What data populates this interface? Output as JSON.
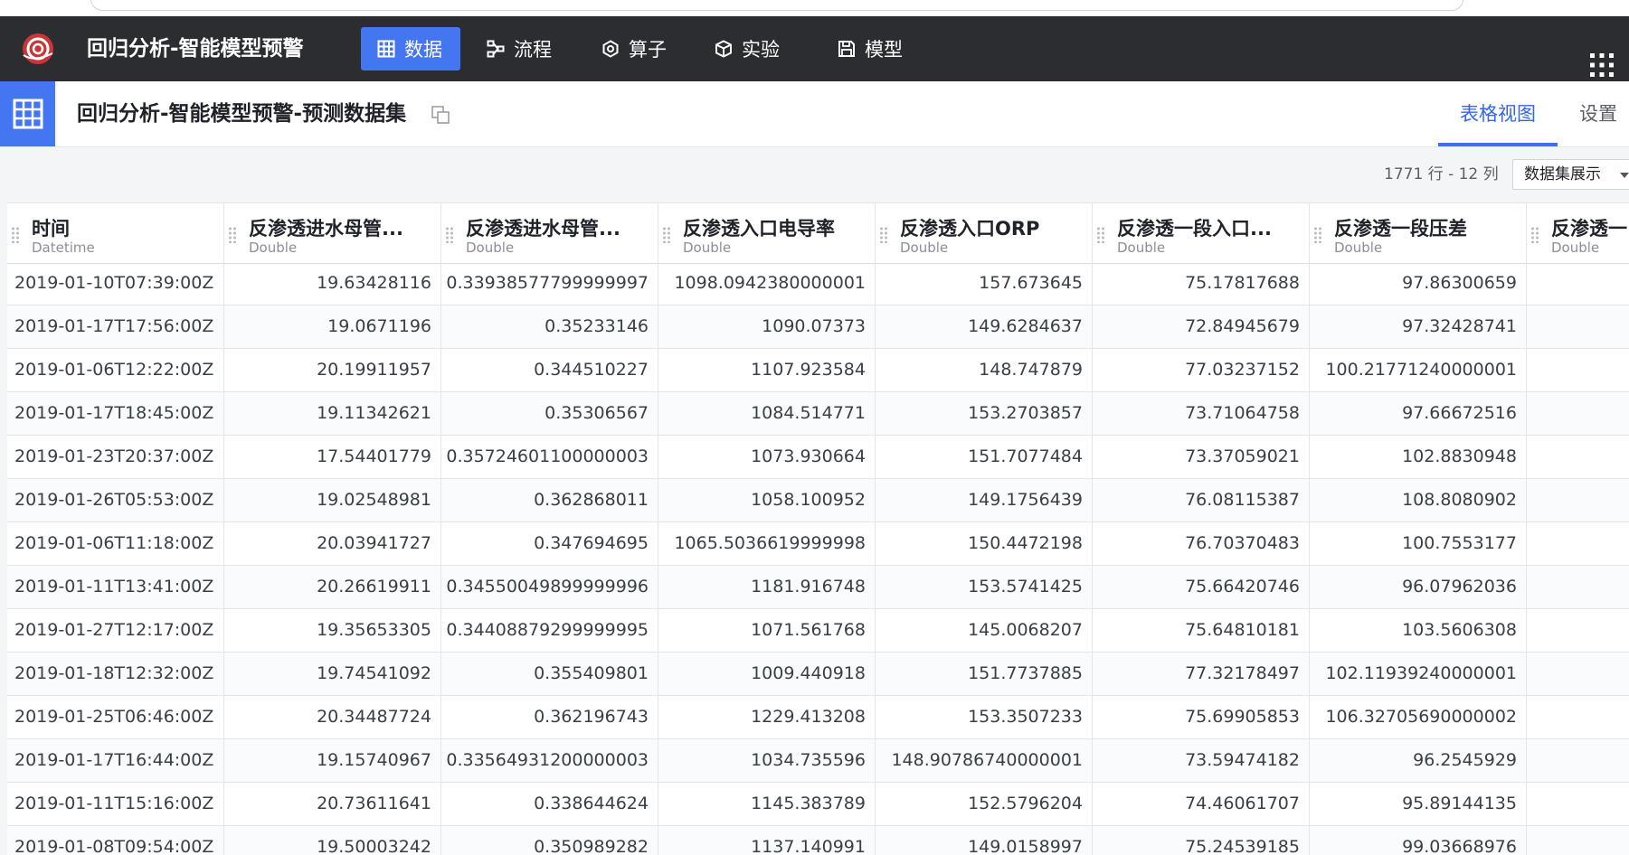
{
  "app": {
    "title": "回归分析-智能模型预警",
    "accent_color": "#4476f2",
    "topbar_color": "#2b2d30"
  },
  "nav": [
    {
      "label": "数据",
      "icon": "table-icon",
      "active": true
    },
    {
      "label": "流程",
      "icon": "flow-icon",
      "active": false
    },
    {
      "label": "算子",
      "icon": "operator-icon",
      "active": false
    },
    {
      "label": "实验",
      "icon": "cube-icon",
      "active": false
    },
    {
      "label": "模型",
      "icon": "save-icon",
      "active": false
    }
  ],
  "dataset": {
    "title": "回归分析-智能模型预警-预测数据集",
    "tabs": {
      "table_view": "表格视图",
      "settings": "设置"
    },
    "row_count": "1771 行 - 12 列",
    "view_select": "数据集展示"
  },
  "columns": [
    {
      "name": "时间",
      "type": "Datetime"
    },
    {
      "name": "反渗透进水母管...",
      "type": "Double"
    },
    {
      "name": "反渗透进水母管...",
      "type": "Double"
    },
    {
      "name": "反渗透入口电导率",
      "type": "Double"
    },
    {
      "name": "反渗透入口ORP",
      "type": "Double"
    },
    {
      "name": "反渗透一段入口...",
      "type": "Double"
    },
    {
      "name": "反渗透一段压差",
      "type": "Double"
    },
    {
      "name": "反渗透一",
      "type": "Double"
    }
  ],
  "rows": [
    [
      "2019-01-10T07:39:00Z",
      "19.63428116",
      "0.33938577799999997",
      "1098.0942380000001",
      "157.673645",
      "75.17817688",
      "97.86300659",
      ""
    ],
    [
      "2019-01-17T17:56:00Z",
      "19.0671196",
      "0.35233146",
      "1090.07373",
      "149.6284637",
      "72.84945679",
      "97.32428741",
      ""
    ],
    [
      "2019-01-06T12:22:00Z",
      "20.19911957",
      "0.344510227",
      "1107.923584",
      "148.747879",
      "77.03237152",
      "100.21771240000001",
      ""
    ],
    [
      "2019-01-17T18:45:00Z",
      "19.11342621",
      "0.35306567",
      "1084.514771",
      "153.2703857",
      "73.71064758",
      "97.66672516",
      ""
    ],
    [
      "2019-01-23T20:37:00Z",
      "17.54401779",
      "0.35724601100000003",
      "1073.930664",
      "151.7077484",
      "73.37059021",
      "102.8830948",
      ""
    ],
    [
      "2019-01-26T05:53:00Z",
      "19.02548981",
      "0.362868011",
      "1058.100952",
      "149.1756439",
      "76.08115387",
      "108.8080902",
      ""
    ],
    [
      "2019-01-06T11:18:00Z",
      "20.03941727",
      "0.347694695",
      "1065.5036619999998",
      "150.4472198",
      "76.70370483",
      "100.7553177",
      ""
    ],
    [
      "2019-01-11T13:41:00Z",
      "20.26619911",
      "0.34550049899999996",
      "1181.916748",
      "153.5741425",
      "75.66420746",
      "96.07962036",
      ""
    ],
    [
      "2019-01-27T12:17:00Z",
      "19.35653305",
      "0.34408879299999995",
      "1071.561768",
      "145.0068207",
      "75.64810181",
      "103.5606308",
      ""
    ],
    [
      "2019-01-18T12:32:00Z",
      "19.74541092",
      "0.355409801",
      "1009.440918",
      "151.7737885",
      "77.32178497",
      "102.11939240000001",
      ""
    ],
    [
      "2019-01-25T06:46:00Z",
      "20.34487724",
      "0.362196743",
      "1229.413208",
      "153.3507233",
      "75.69905853",
      "106.32705690000002",
      ""
    ],
    [
      "2019-01-17T16:44:00Z",
      "19.15740967",
      "0.33564931200000003",
      "1034.735596",
      "148.90786740000001",
      "73.59474182",
      "96.2545929",
      ""
    ],
    [
      "2019-01-11T15:16:00Z",
      "20.73611641",
      "0.338644624",
      "1145.383789",
      "152.5796204",
      "74.46061707",
      "95.89144135",
      ""
    ],
    [
      "2019-01-08T09:54:00Z",
      "19.50003242",
      "0.350989282",
      "1137.140991",
      "149.0158997",
      "75.24539185",
      "99.03668976",
      ""
    ]
  ]
}
